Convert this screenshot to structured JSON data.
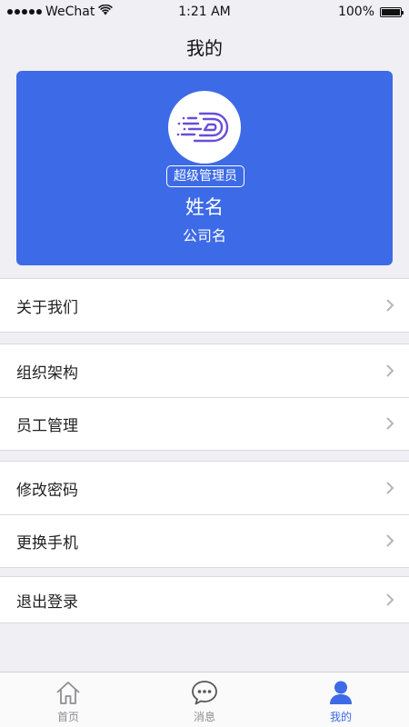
{
  "status_bar": {
    "carrier": "WeChat",
    "time": "1:21 AM",
    "battery": "100%",
    "battery_level": 1.0
  },
  "header": {
    "title": "我的"
  },
  "profile": {
    "role_badge": "超级管理员",
    "name": "姓名",
    "company": "公司名",
    "card_color": "#3d6ae6"
  },
  "menu": {
    "about": "关于我们",
    "org_structure": "组织架构",
    "staff_management": "员工管理",
    "change_password": "修改密码",
    "change_phone": "更换手机",
    "logout": "退出登录"
  },
  "tabbar": {
    "tabs": [
      {
        "label": "首页",
        "icon": "home-icon"
      },
      {
        "label": "消息",
        "icon": "chat-bubble-icon"
      },
      {
        "label": "我的",
        "icon": "person-icon"
      }
    ],
    "active_index": 2,
    "active_color": "#3d6ae6"
  }
}
